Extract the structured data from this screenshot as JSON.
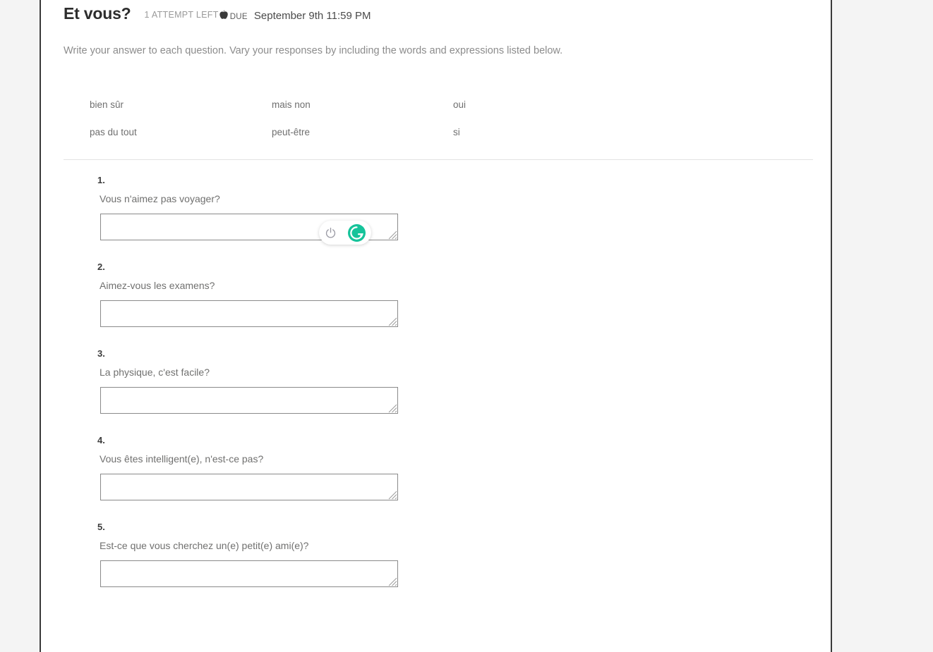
{
  "assignment": {
    "title": "Et vous?",
    "attempts_label": "1 ATTEMPT LEFT",
    "attempts_icon": "apple-icon",
    "due_label": "DUE",
    "due_date": "September 9th 11:59 PM",
    "instructions": "Write your answer to each question. Vary your responses by including the words and expressions listed below."
  },
  "word_bank": {
    "rows": [
      [
        "bien sûr",
        "mais non",
        "oui"
      ],
      [
        "pas du tout",
        "peut-être",
        "si"
      ]
    ]
  },
  "questions": [
    {
      "number": "1.",
      "text": "Vous n'aimez pas voyager?",
      "answer": "",
      "placeholder": ""
    },
    {
      "number": "2.",
      "text": "Aimez-vous les examens?",
      "answer": "",
      "placeholder": ""
    },
    {
      "number": "3.",
      "text": "La physique, c'est facile?",
      "answer": "",
      "placeholder": ""
    },
    {
      "number": "4.",
      "text": "Vous êtes intelligent(e), n'est-ce pas?",
      "answer": "",
      "placeholder": ""
    },
    {
      "number": "5.",
      "text": "Est-ce que vous cherchez un(e) petit(e) ami(e)?",
      "answer": "",
      "placeholder": ""
    }
  ],
  "grammarly_widget": {
    "attached_to_question": "1.",
    "power_icon": "power-icon",
    "logo_icon": "grammarly-g-icon",
    "logo_color": "#15c39a"
  },
  "colors": {
    "page_background": "#f4f4f4",
    "sheet_background": "#ffffff",
    "sheet_border": "#3a3a3a",
    "title_text": "#2d2d2d",
    "body_text": "#70706f",
    "muted_text": "#9a9a9a",
    "divider": "#e2e2e2",
    "input_border": "#8a8a8a",
    "grammarly_green": "#15c39a"
  }
}
